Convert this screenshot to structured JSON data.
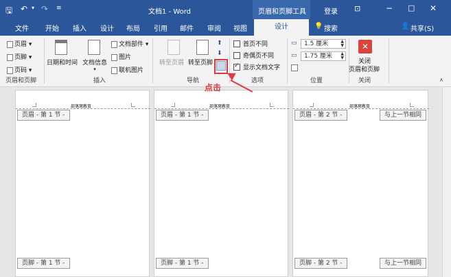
{
  "titlebar": {
    "save_icon": "save-icon",
    "undo_icon": "undo-icon",
    "redo_icon": "redo-icon",
    "customize_icon": "customize-quick-access-icon",
    "title": "文档1 - Word",
    "context_tools": "页眉和页脚工具",
    "login": "登录",
    "ribbon_options_icon": "ribbon-display-options-icon",
    "minimize_icon": "minimize-icon",
    "maximize_icon": "maximize-icon",
    "close_icon": "close-icon"
  },
  "tabs": {
    "file": "文件",
    "home": "开始",
    "insert": "插入",
    "design": "设计",
    "layout": "布局",
    "references": "引用",
    "mailings": "邮件",
    "review": "审阅",
    "view": "视图",
    "design_active": "设计",
    "tellme": "搜索",
    "share": "共享(S)"
  },
  "ribbon": {
    "hf_group": {
      "header": "页眉",
      "footer": "页脚",
      "page_number": "页码",
      "label": "页眉和页脚"
    },
    "insert_group": {
      "datetime": "日期和时间",
      "docinfo": "文档信息",
      "quickparts": "文档部件",
      "picture": "图片",
      "online_picture": "联机图片",
      "label": "插入"
    },
    "nav_group": {
      "goto_header": "转至页眉",
      "goto_footer": "转至页脚",
      "label": "导航"
    },
    "options_group": {
      "first_page": "首页不同",
      "odd_even": "奇偶页不同",
      "show_text": "显示文档文字",
      "label": "选项"
    },
    "position_group": {
      "header_pos": "1.5 厘米",
      "footer_pos": "1.75 厘米",
      "label": "位置"
    },
    "close_group": {
      "close_line1": "关闭",
      "close_line2": "页眉和页脚",
      "label": "关闭"
    }
  },
  "annotation": {
    "text": "点击"
  },
  "pages": [
    {
      "header_text": "部落窝教育",
      "header_tag": "页眉 - 第 1 节 -",
      "footer_tag": "页脚 - 第 1 节 -"
    },
    {
      "header_text": "部落窝教育",
      "header_tag": "页眉 - 第 1 节 -",
      "footer_tag": "页脚 - 第 1 节 -"
    },
    {
      "header_text": "部落窝教育",
      "header_tag": "页眉 - 第 2 节 -",
      "footer_tag": "页脚 - 第 2 节 -",
      "same_as_prev": "与上一节相同",
      "same_as_prev_footer": "与上一节相同"
    }
  ],
  "colors": {
    "brand": "#2b579a",
    "annotation": "#e0393e"
  }
}
